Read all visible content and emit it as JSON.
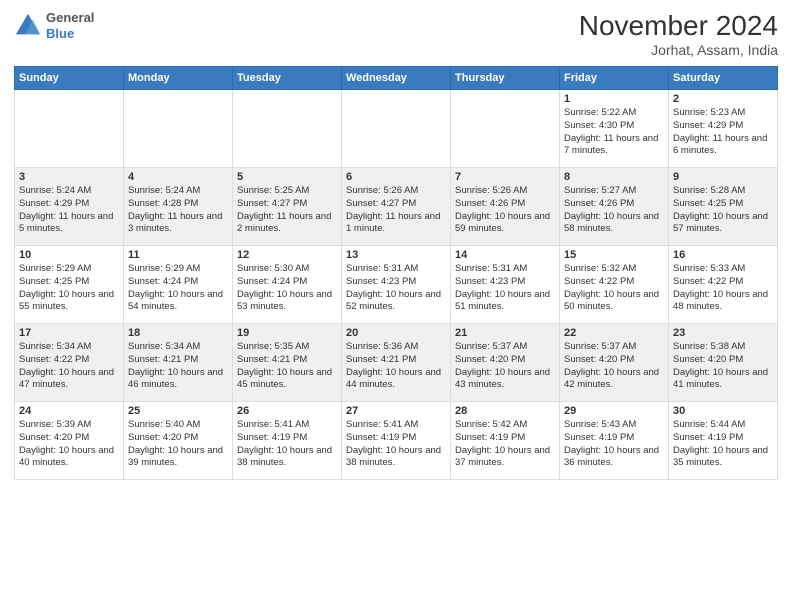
{
  "header": {
    "logo": {
      "general": "General",
      "blue": "Blue"
    },
    "title": "November 2024",
    "location": "Jorhat, Assam, India"
  },
  "calendar": {
    "weekdays": [
      "Sunday",
      "Monday",
      "Tuesday",
      "Wednesday",
      "Thursday",
      "Friday",
      "Saturday"
    ],
    "weeks": [
      [
        {
          "day": "",
          "content": ""
        },
        {
          "day": "",
          "content": ""
        },
        {
          "day": "",
          "content": ""
        },
        {
          "day": "",
          "content": ""
        },
        {
          "day": "",
          "content": ""
        },
        {
          "day": "1",
          "content": "Sunrise: 5:22 AM\nSunset: 4:30 PM\nDaylight: 11 hours and 7 minutes."
        },
        {
          "day": "2",
          "content": "Sunrise: 5:23 AM\nSunset: 4:29 PM\nDaylight: 11 hours and 6 minutes."
        }
      ],
      [
        {
          "day": "3",
          "content": "Sunrise: 5:24 AM\nSunset: 4:29 PM\nDaylight: 11 hours and 5 minutes."
        },
        {
          "day": "4",
          "content": "Sunrise: 5:24 AM\nSunset: 4:28 PM\nDaylight: 11 hours and 3 minutes."
        },
        {
          "day": "5",
          "content": "Sunrise: 5:25 AM\nSunset: 4:27 PM\nDaylight: 11 hours and 2 minutes."
        },
        {
          "day": "6",
          "content": "Sunrise: 5:26 AM\nSunset: 4:27 PM\nDaylight: 11 hours and 1 minute."
        },
        {
          "day": "7",
          "content": "Sunrise: 5:26 AM\nSunset: 4:26 PM\nDaylight: 10 hours and 59 minutes."
        },
        {
          "day": "8",
          "content": "Sunrise: 5:27 AM\nSunset: 4:26 PM\nDaylight: 10 hours and 58 minutes."
        },
        {
          "day": "9",
          "content": "Sunrise: 5:28 AM\nSunset: 4:25 PM\nDaylight: 10 hours and 57 minutes."
        }
      ],
      [
        {
          "day": "10",
          "content": "Sunrise: 5:29 AM\nSunset: 4:25 PM\nDaylight: 10 hours and 55 minutes."
        },
        {
          "day": "11",
          "content": "Sunrise: 5:29 AM\nSunset: 4:24 PM\nDaylight: 10 hours and 54 minutes."
        },
        {
          "day": "12",
          "content": "Sunrise: 5:30 AM\nSunset: 4:24 PM\nDaylight: 10 hours and 53 minutes."
        },
        {
          "day": "13",
          "content": "Sunrise: 5:31 AM\nSunset: 4:23 PM\nDaylight: 10 hours and 52 minutes."
        },
        {
          "day": "14",
          "content": "Sunrise: 5:31 AM\nSunset: 4:23 PM\nDaylight: 10 hours and 51 minutes."
        },
        {
          "day": "15",
          "content": "Sunrise: 5:32 AM\nSunset: 4:22 PM\nDaylight: 10 hours and 50 minutes."
        },
        {
          "day": "16",
          "content": "Sunrise: 5:33 AM\nSunset: 4:22 PM\nDaylight: 10 hours and 48 minutes."
        }
      ],
      [
        {
          "day": "17",
          "content": "Sunrise: 5:34 AM\nSunset: 4:22 PM\nDaylight: 10 hours and 47 minutes."
        },
        {
          "day": "18",
          "content": "Sunrise: 5:34 AM\nSunset: 4:21 PM\nDaylight: 10 hours and 46 minutes."
        },
        {
          "day": "19",
          "content": "Sunrise: 5:35 AM\nSunset: 4:21 PM\nDaylight: 10 hours and 45 minutes."
        },
        {
          "day": "20",
          "content": "Sunrise: 5:36 AM\nSunset: 4:21 PM\nDaylight: 10 hours and 44 minutes."
        },
        {
          "day": "21",
          "content": "Sunrise: 5:37 AM\nSunset: 4:20 PM\nDaylight: 10 hours and 43 minutes."
        },
        {
          "day": "22",
          "content": "Sunrise: 5:37 AM\nSunset: 4:20 PM\nDaylight: 10 hours and 42 minutes."
        },
        {
          "day": "23",
          "content": "Sunrise: 5:38 AM\nSunset: 4:20 PM\nDaylight: 10 hours and 41 minutes."
        }
      ],
      [
        {
          "day": "24",
          "content": "Sunrise: 5:39 AM\nSunset: 4:20 PM\nDaylight: 10 hours and 40 minutes."
        },
        {
          "day": "25",
          "content": "Sunrise: 5:40 AM\nSunset: 4:20 PM\nDaylight: 10 hours and 39 minutes."
        },
        {
          "day": "26",
          "content": "Sunrise: 5:41 AM\nSunset: 4:19 PM\nDaylight: 10 hours and 38 minutes."
        },
        {
          "day": "27",
          "content": "Sunrise: 5:41 AM\nSunset: 4:19 PM\nDaylight: 10 hours and 38 minutes."
        },
        {
          "day": "28",
          "content": "Sunrise: 5:42 AM\nSunset: 4:19 PM\nDaylight: 10 hours and 37 minutes."
        },
        {
          "day": "29",
          "content": "Sunrise: 5:43 AM\nSunset: 4:19 PM\nDaylight: 10 hours and 36 minutes."
        },
        {
          "day": "30",
          "content": "Sunrise: 5:44 AM\nSunset: 4:19 PM\nDaylight: 10 hours and 35 minutes."
        }
      ]
    ]
  }
}
